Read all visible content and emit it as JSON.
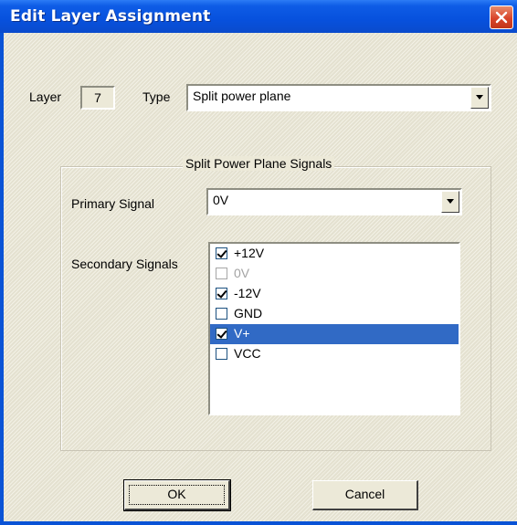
{
  "window": {
    "title": "Edit Layer Assignment",
    "close_icon": "close-icon"
  },
  "layer": {
    "label": "Layer",
    "value": "7"
  },
  "type": {
    "label": "Type",
    "value": "Split power plane"
  },
  "group": {
    "title": "Split Power Plane Signals",
    "primary_label": "Primary Signal",
    "primary_value": "0V",
    "secondary_label": "Secondary Signals",
    "secondary_items": [
      {
        "label": "+12V",
        "checked": true,
        "enabled": true,
        "selected": false
      },
      {
        "label": "0V",
        "checked": false,
        "enabled": false,
        "selected": false
      },
      {
        "label": "-12V",
        "checked": true,
        "enabled": true,
        "selected": false
      },
      {
        "label": "GND",
        "checked": false,
        "enabled": true,
        "selected": false
      },
      {
        "label": "V+",
        "checked": true,
        "enabled": true,
        "selected": true
      },
      {
        "label": "VCC",
        "checked": false,
        "enabled": true,
        "selected": false
      }
    ]
  },
  "buttons": {
    "ok": "OK",
    "cancel": "Cancel"
  },
  "colors": {
    "titlebar": "#0751dd",
    "selection": "#316ac5",
    "dialog_bg": "#ece9d8"
  }
}
